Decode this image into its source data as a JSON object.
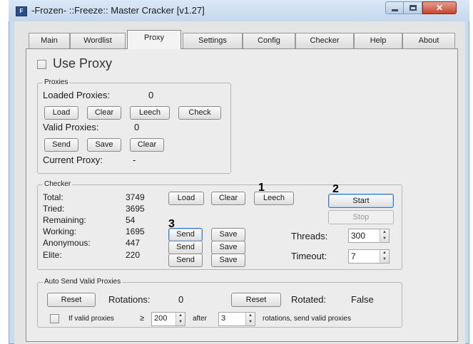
{
  "window": {
    "title": "-Frozen- ::Freeze:: Master Cracker [v1.27]",
    "close_glyph": "✕"
  },
  "tabs": [
    "Main",
    "Wordlist",
    "Proxy",
    "Settings",
    "Config",
    "Checker",
    "Help",
    "About"
  ],
  "use_proxy_label": "Use Proxy",
  "proxies": {
    "group_label": "Proxies",
    "loaded_label": "Loaded Proxies:",
    "loaded_value": "0",
    "load": "Load",
    "clear": "Clear",
    "leech": "Leech",
    "check": "Check",
    "valid_label": "Valid Proxies:",
    "valid_value": "0",
    "send": "Send",
    "save": "Save",
    "clear2": "Clear",
    "current_label": "Current Proxy:",
    "current_value": "-"
  },
  "checker": {
    "group_label": "Checker",
    "stats": [
      {
        "label": "Total:",
        "value": "3749"
      },
      {
        "label": "Tried:",
        "value": "3695"
      },
      {
        "label": "Remaining:",
        "value": "54"
      },
      {
        "label": "Working:",
        "value": "1695"
      },
      {
        "label": "Anonymous:",
        "value": "447"
      },
      {
        "label": "Elite:",
        "value": "220"
      }
    ],
    "load": "Load",
    "clear": "Clear",
    "leech": "Leech",
    "start": "Start",
    "stop": "Stop",
    "send": "Send",
    "save": "Save",
    "threads_label": "Threads:",
    "threads_value": "300",
    "timeout_label": "Timeout:",
    "timeout_value": "7",
    "markers": [
      "1",
      "2",
      "3"
    ]
  },
  "auto_send": {
    "group_label": "Auto Send Valid Proxies",
    "reset": "Reset",
    "rotations_label": "Rotations:",
    "rotations_value": "0",
    "rotated_label": "Rotated:",
    "rotated_value": "False",
    "if_valid_label": "If valid proxies",
    "gte": "≥",
    "threshold_value": "200",
    "after_label": "after",
    "after_value": "3",
    "tail_label": "rotations, send valid proxies"
  }
}
